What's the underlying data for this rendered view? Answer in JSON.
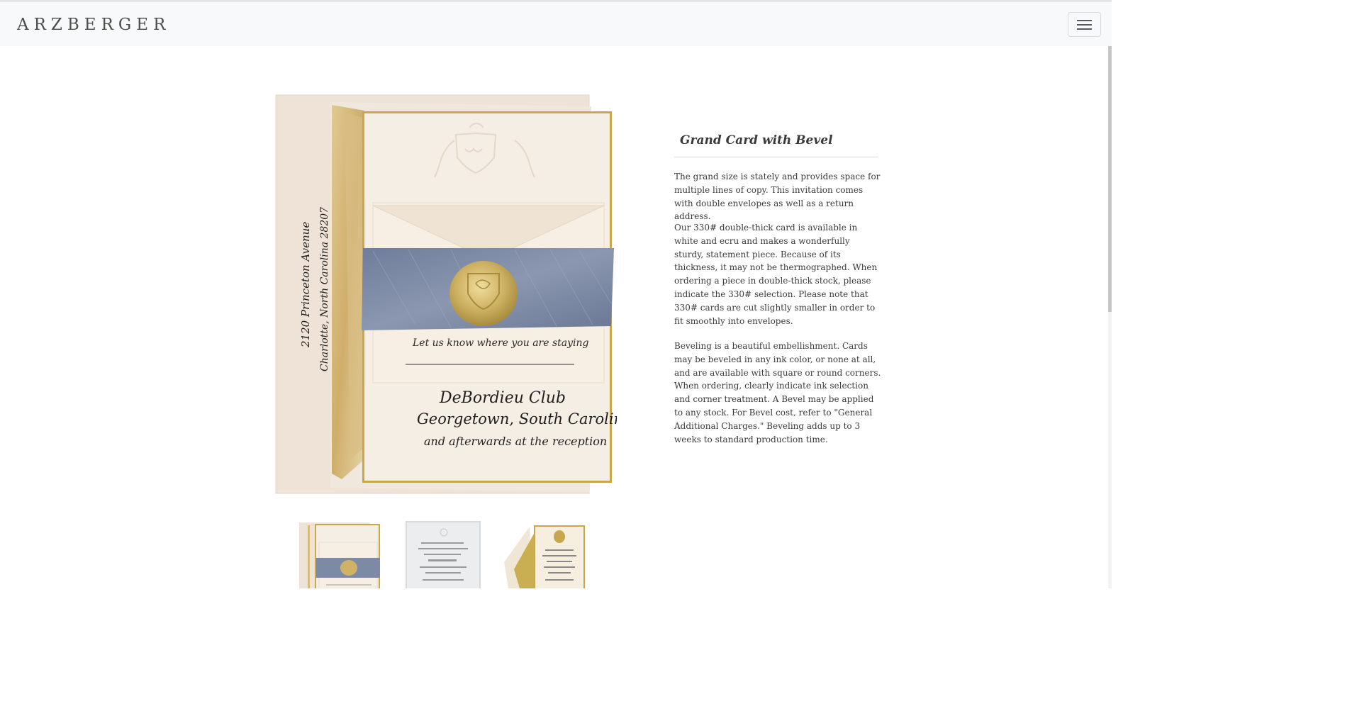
{
  "header": {
    "brand": "ARZBERGER",
    "menu_toggle_icon": "hamburger-icon"
  },
  "product": {
    "title": "Grand Card with Bevel",
    "paragraphs": [
      "The grand size is stately and provides space for multiple lines of copy. This invitation comes with double envelopes as well as a return address.",
      "Our 330# double-thick card is available in white and ecru and makes a wonderfully sturdy, statement piece. Because of its thickness, it may not be thermographed. When ordering a piece in double-thick stock, please indicate the 330# selection. Please note that 330# cards are cut slightly smaller in order to fit smoothly into envelopes.",
      "Beveling is a beautiful embellishment. Cards may be beveled in any ink color, or none at all, and are available with square or round corners. When ordering, clearly indicate ink selection and corner treatment. A Bevel may be applied to any stock. For Bevel cost, refer to \"General Additional Charges.\" Beveling adds up to 3 weeks to standard production time."
    ],
    "image_text": {
      "envelope_address_line1": "2120 Princeton Avenue",
      "envelope_address_line2": "Charlotte, North Carolina 28207",
      "rsvp_line": "Let us know where you are staying",
      "venue_line1": "DeBordieu Club",
      "venue_line2": "Georgetown, South Carolina",
      "venue_line3": "and afterwards at the reception"
    },
    "thumbnails": [
      {
        "name": "thumbnail-blue-ribbon-suite"
      },
      {
        "name": "thumbnail-white-card"
      },
      {
        "name": "thumbnail-gold-crest-card"
      }
    ]
  },
  "colors": {
    "navbar_bg": "#f8f9fa",
    "text": "#3a3a3a",
    "gold_bevel": "#c9a84c",
    "ribbon_blue": "#7d8aa6",
    "card_cream": "#f3ebe0"
  }
}
